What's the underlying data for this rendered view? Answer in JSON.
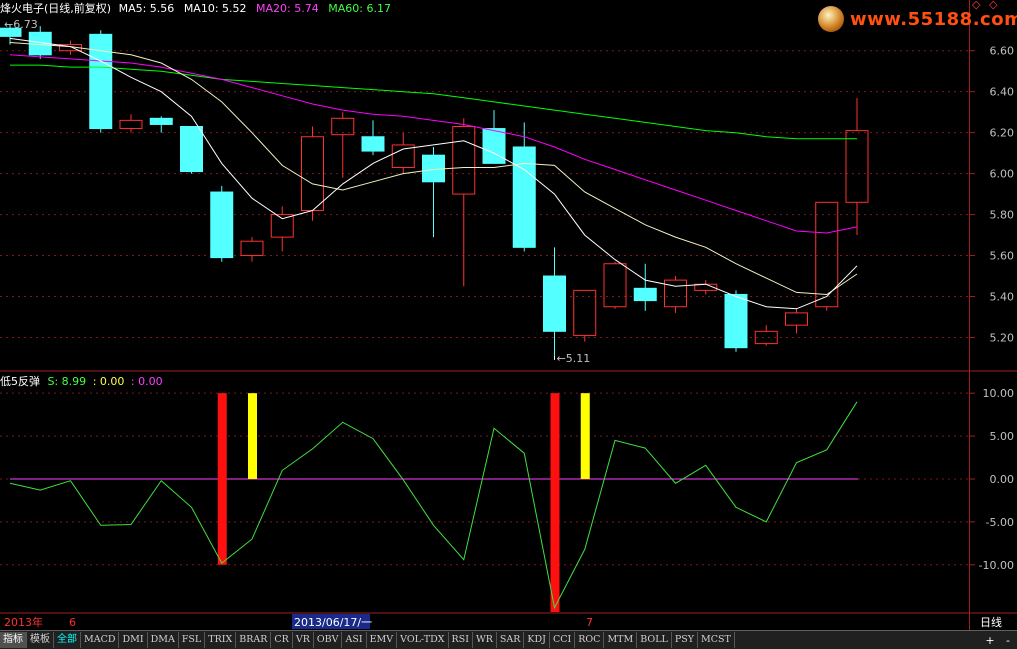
{
  "header": {
    "title": "烽火电子(日线,前复权)",
    "ma5": "MA5: 5.56",
    "ma10": "MA10: 5.52",
    "ma20": "MA20: 5.74",
    "ma60": "MA60: 6.17",
    "ma5_color": "#ffffff",
    "ma10_color": "#ffffff",
    "ma20_color": "#ff00ff",
    "ma60_color": "#00ff00",
    "high_marker": "6.73"
  },
  "logo": {
    "text": "www.55188.com"
  },
  "low_marker": "5.11",
  "price_axis": [
    "6.60",
    "6.40",
    "6.20",
    "6.00",
    "5.80",
    "5.60",
    "5.40",
    "5.20"
  ],
  "indicator": {
    "name": "低5反弹",
    "s_label": "S: 8.99",
    "zero_label": ": 0.00",
    "ref_label": ": 0.00",
    "axis": [
      "10.00",
      "5.00",
      "0.00",
      "-5.00",
      "-10.00"
    ]
  },
  "date_axis": {
    "year": "2013年",
    "month6": "6",
    "selected_date": "2013/06/17/一",
    "month7": "7",
    "period": "日线"
  },
  "chart_data": {
    "type": "candlestick",
    "up_color": "#ff3030",
    "down_color": "#54ffff",
    "price_range": [
      5.09,
      6.75
    ],
    "candles": [
      {
        "o": 6.71,
        "h": 6.73,
        "l": 6.63,
        "c": 6.67
      },
      {
        "o": 6.69,
        "h": 6.72,
        "l": 6.56,
        "c": 6.58
      },
      {
        "o": 6.6,
        "h": 6.65,
        "l": 6.58,
        "c": 6.63
      },
      {
        "o": 6.68,
        "h": 6.7,
        "l": 6.2,
        "c": 6.22
      },
      {
        "o": 6.22,
        "h": 6.29,
        "l": 6.2,
        "c": 6.26
      },
      {
        "o": 6.27,
        "h": 6.28,
        "l": 6.2,
        "c": 6.24
      },
      {
        "o": 6.23,
        "h": 6.23,
        "l": 6.0,
        "c": 6.01
      },
      {
        "o": 5.91,
        "h": 5.94,
        "l": 5.57,
        "c": 5.59
      },
      {
        "o": 5.6,
        "h": 5.69,
        "l": 5.57,
        "c": 5.67
      },
      {
        "o": 5.69,
        "h": 5.84,
        "l": 5.62,
        "c": 5.8
      },
      {
        "o": 5.82,
        "h": 6.23,
        "l": 5.77,
        "c": 6.18
      },
      {
        "o": 6.19,
        "h": 6.3,
        "l": 5.98,
        "c": 6.27
      },
      {
        "o": 6.18,
        "h": 6.26,
        "l": 6.09,
        "c": 6.11
      },
      {
        "o": 6.03,
        "h": 6.2,
        "l": 6.0,
        "c": 6.14
      },
      {
        "o": 6.09,
        "h": 6.13,
        "l": 5.69,
        "c": 5.96
      },
      {
        "o": 5.9,
        "h": 6.27,
        "l": 5.45,
        "c": 6.23
      },
      {
        "o": 6.22,
        "h": 6.31,
        "l": 6.05,
        "c": 6.05
      },
      {
        "o": 6.13,
        "h": 6.25,
        "l": 5.62,
        "c": 5.64
      },
      {
        "o": 5.5,
        "h": 5.64,
        "l": 5.11,
        "c": 5.23
      },
      {
        "o": 5.21,
        "h": 5.43,
        "l": 5.18,
        "c": 5.43
      },
      {
        "o": 5.35,
        "h": 5.57,
        "l": 5.34,
        "c": 5.56
      },
      {
        "o": 5.44,
        "h": 5.56,
        "l": 5.33,
        "c": 5.38
      },
      {
        "o": 5.35,
        "h": 5.5,
        "l": 5.32,
        "c": 5.48
      },
      {
        "o": 5.43,
        "h": 5.48,
        "l": 5.41,
        "c": 5.46
      },
      {
        "o": 5.41,
        "h": 5.43,
        "l": 5.13,
        "c": 5.15
      },
      {
        "o": 5.17,
        "h": 5.26,
        "l": 5.16,
        "c": 5.23
      },
      {
        "o": 5.26,
        "h": 5.34,
        "l": 5.22,
        "c": 5.32
      },
      {
        "o": 5.35,
        "h": 5.86,
        "l": 5.33,
        "c": 5.86
      },
      {
        "o": 5.86,
        "h": 6.37,
        "l": 5.7,
        "c": 6.21
      }
    ],
    "ma5": [
      6.66,
      6.64,
      6.62,
      6.55,
      6.47,
      6.4,
      6.28,
      6.05,
      5.88,
      5.78,
      5.82,
      5.95,
      6.05,
      6.12,
      6.14,
      6.16,
      6.1,
      6.02,
      5.9,
      5.7,
      5.58,
      5.48,
      5.45,
      5.46,
      5.4,
      5.35,
      5.34,
      5.4,
      5.55
    ],
    "ma10": [
      6.64,
      6.63,
      6.62,
      6.6,
      6.58,
      6.54,
      6.46,
      6.35,
      6.2,
      6.04,
      5.95,
      5.92,
      5.96,
      6.0,
      6.02,
      6.03,
      6.03,
      6.05,
      6.04,
      5.91,
      5.83,
      5.75,
      5.69,
      5.64,
      5.56,
      5.49,
      5.42,
      5.41,
      5.51
    ],
    "ma20": [
      6.58,
      6.57,
      6.56,
      6.55,
      6.54,
      6.52,
      6.49,
      6.46,
      6.42,
      6.38,
      6.34,
      6.31,
      6.29,
      6.28,
      6.26,
      6.24,
      6.21,
      6.18,
      6.13,
      6.07,
      6.02,
      5.97,
      5.92,
      5.87,
      5.82,
      5.77,
      5.72,
      5.71,
      5.74
    ],
    "ma60": [
      6.53,
      6.53,
      6.52,
      6.52,
      6.51,
      6.5,
      6.48,
      6.46,
      6.45,
      6.44,
      6.43,
      6.42,
      6.41,
      6.4,
      6.39,
      6.37,
      6.35,
      6.33,
      6.31,
      6.29,
      6.27,
      6.25,
      6.23,
      6.21,
      6.2,
      6.18,
      6.17,
      6.17,
      6.17
    ],
    "indicator_range": [
      -15.5,
      12
    ],
    "s_line": [
      -0.5,
      -1.3,
      -0.2,
      -5.4,
      -5.3,
      -0.2,
      -3.3,
      -9.8,
      -7.0,
      1.0,
      3.5,
      6.6,
      4.7,
      -0.1,
      -5.4,
      -9.4,
      5.9,
      3.0,
      -15.0,
      -8.2,
      4.5,
      3.6,
      -0.5,
      1.6,
      -3.3,
      -5.0,
      1.9,
      3.4,
      8.99
    ],
    "signals": [
      {
        "index": 7,
        "color": "#ff1010",
        "top": 10.0,
        "bottom": -10.0
      },
      {
        "index": 8,
        "color": "#ffff00",
        "top": 10.0,
        "bottom": 0.0
      },
      {
        "index": 18,
        "color": "#ff1010",
        "top": 10.0,
        "bottom": -15.5
      },
      {
        "index": 19,
        "color": "#ffff00",
        "top": 10.0,
        "bottom": 0.0
      }
    ]
  },
  "tabs": [
    "指标",
    "模板",
    "全部",
    "MACD",
    "DMI",
    "DMA",
    "FSL",
    "TRIX",
    "BRAR",
    "CR",
    "VR",
    "OBV",
    "ASI",
    "EMV",
    "VOL-TDX",
    "RSI",
    "WR",
    "SAR",
    "KDJ",
    "CCI",
    "ROC",
    "MTM",
    "BOLL",
    "PSY",
    "MCST"
  ],
  "controls": {
    "plus": "+",
    "minus": "-"
  }
}
